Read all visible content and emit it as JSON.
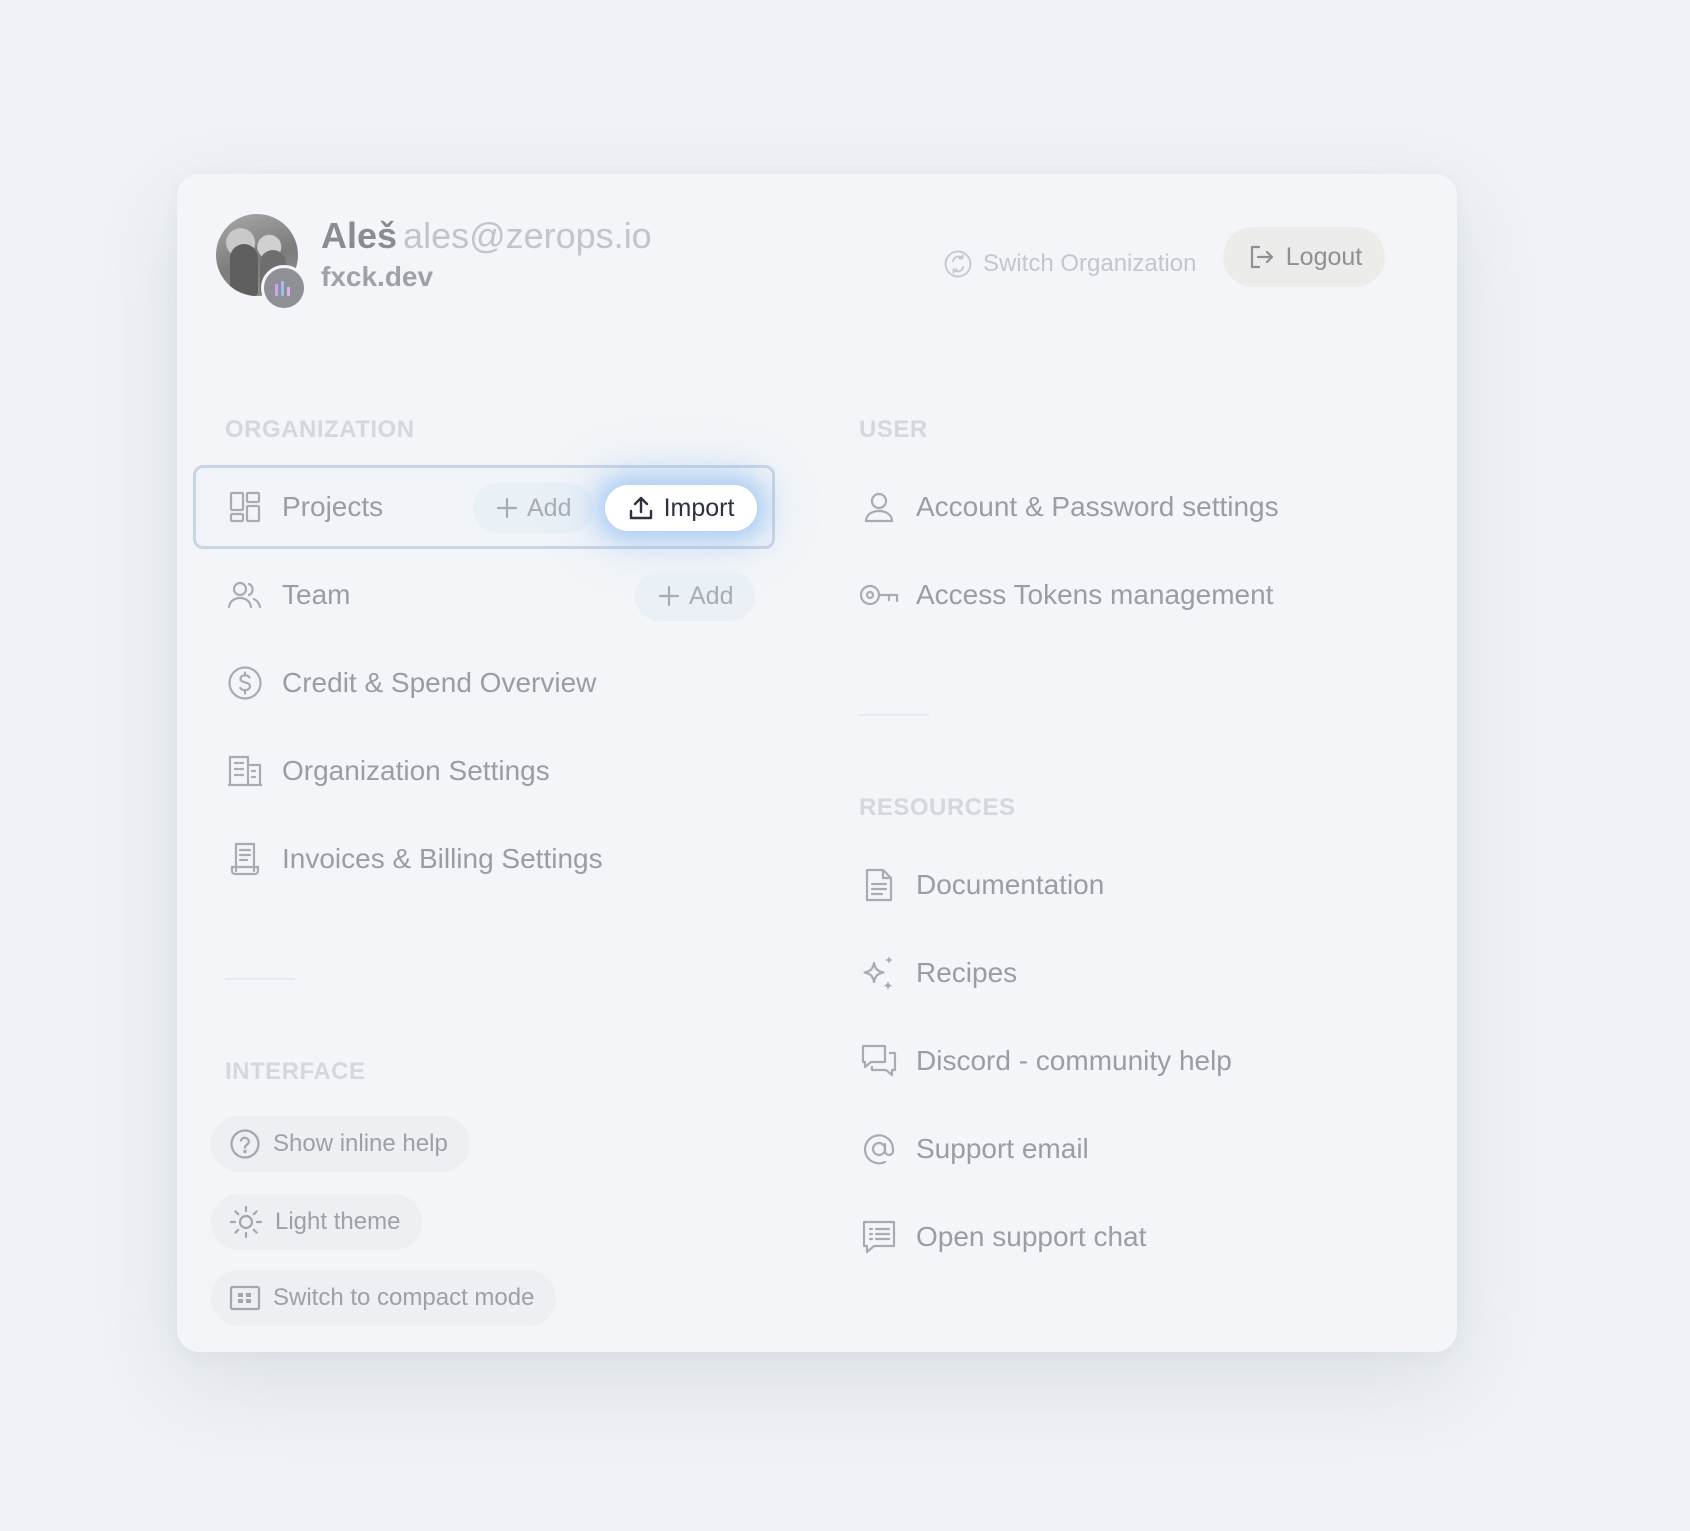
{
  "header": {
    "user_name": "Aleš",
    "user_email": "ales@zerops.io",
    "org_name": "fxck.dev",
    "switch_org_label": "Switch Organization",
    "logout_label": "Logout"
  },
  "organization": {
    "title": "ORGANIZATION",
    "projects_label": "Projects",
    "projects_add_label": "Add",
    "projects_import_label": "Import",
    "team_label": "Team",
    "team_add_label": "Add",
    "credit_label": "Credit & Spend Overview",
    "org_settings_label": "Organization Settings",
    "invoices_label": "Invoices & Billing Settings"
  },
  "user": {
    "title": "USER",
    "account_label": "Account & Password settings",
    "tokens_label": "Access Tokens management"
  },
  "resources": {
    "title": "RESOURCES",
    "items": [
      {
        "label": "Documentation",
        "icon": "document-icon"
      },
      {
        "label": "Recipes",
        "icon": "sparkles-icon"
      },
      {
        "label": "Discord - community help",
        "icon": "chat-bubbles-icon"
      },
      {
        "label": "Support email",
        "icon": "at-sign-icon"
      },
      {
        "label": "Open support chat",
        "icon": "chat-list-icon"
      }
    ]
  },
  "interface": {
    "title": "INTERFACE",
    "inline_help_label": "Show inline help",
    "theme_label": "Light theme",
    "compact_label": "Switch to compact mode"
  }
}
